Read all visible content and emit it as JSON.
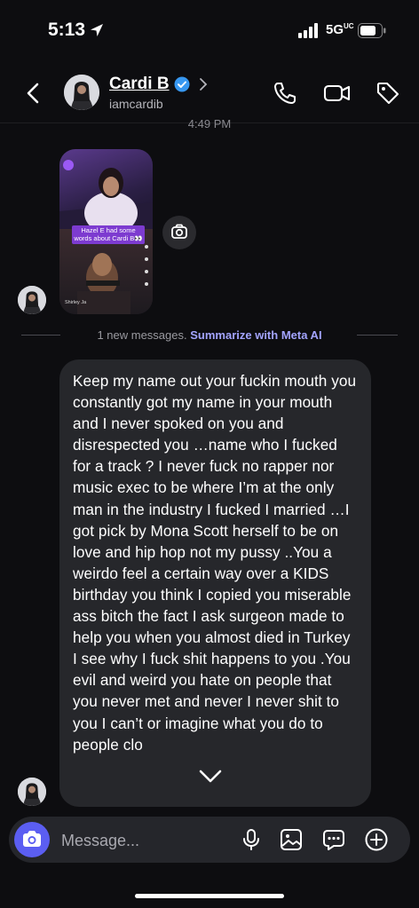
{
  "status_bar": {
    "time": "5:13",
    "network": "5G",
    "network_suffix": "UC"
  },
  "header": {
    "name": "Cardi B",
    "handle": "iamcardib"
  },
  "timestamp": "4:49 PM",
  "shared_post": {
    "caption": "Hazel E had some words about Cardi B👀",
    "author": "Shirley Ja"
  },
  "divider": {
    "text": "1 new messages.",
    "link": "Summarize with Meta AI"
  },
  "message": {
    "text": "Keep my name out your fuckin mouth you constantly got my name in your mouth and I never spoked on you and disrespected you …name who I fucked for a track ? I never fuck no rapper nor music exec to be where I’m at the only man in the industry I fucked I married …I got pick by Mona Scott herself to be on love and hip hop not my pussy ..You a weirdo feel a certain way over a KIDS birthday you think I copied you miserable ass bitch the fact I ask surgeon made to help you when you almost died in Turkey I see why I fuck shit happens to you .You evil and weird you hate on people that you never met and never I never shit to you I can’t or imagine what you do to people clo"
  },
  "composer": {
    "placeholder": "Message..."
  },
  "icons": {
    "back": "chevron-left-icon",
    "verified": "verified-badge-icon",
    "call": "phone-icon",
    "video": "video-camera-icon",
    "tag": "tag-icon",
    "camera": "camera-icon",
    "mic": "microphone-icon",
    "gallery": "image-icon",
    "sticker": "chat-bubble-icon",
    "plus": "plus-circle-icon",
    "scroll_down": "chevron-down-icon"
  },
  "colors": {
    "background": "#0d0d10",
    "bubble": "#26272b",
    "accent": "#5b5ef2",
    "link": "#a3a4ff",
    "verified": "#3797f0"
  }
}
